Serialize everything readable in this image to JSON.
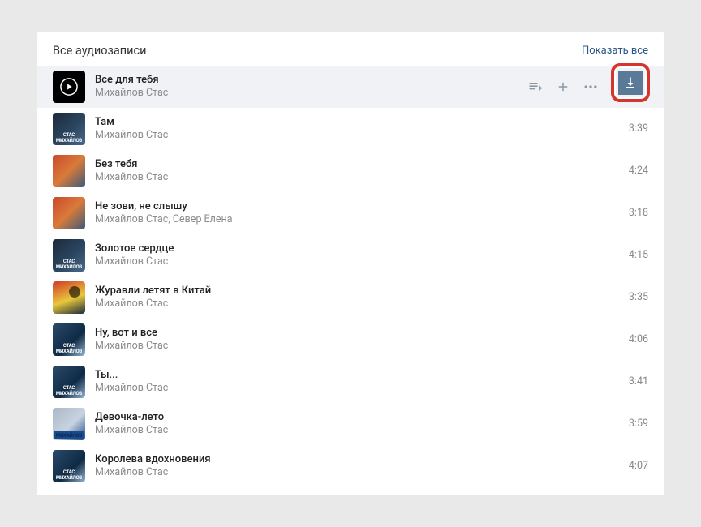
{
  "header": {
    "title": "Все аудиозаписи",
    "show_all": "Показать все"
  },
  "tracks": [
    {
      "title": "Все для тебя",
      "artist": "Михайлов Стас",
      "duration": "",
      "active": true,
      "thumb": "play"
    },
    {
      "title": "Там",
      "artist": "Михайлов Стас",
      "duration": "3:39",
      "thumb": "a"
    },
    {
      "title": "Без тебя",
      "artist": "Михайлов Стас",
      "duration": "4:24",
      "thumb": "b"
    },
    {
      "title": "Не зови, не слышу",
      "artist": "Михайлов Стас, Север Елена",
      "duration": "3:18",
      "thumb": "b"
    },
    {
      "title": "Золотое сердце",
      "artist": "Михайлов Стас",
      "duration": "4:15",
      "thumb": "a"
    },
    {
      "title": "Журавли летят в Китай",
      "artist": "Михайлов Стас",
      "duration": "3:35",
      "thumb": "c"
    },
    {
      "title": "Ну, вот и все",
      "artist": "Михайлов Стас",
      "duration": "4:06",
      "thumb": "d"
    },
    {
      "title": "Ты...",
      "artist": "Михайлов Стас",
      "duration": "3:41",
      "thumb": "d"
    },
    {
      "title": "Девочка-лето",
      "artist": "Михайлов Стас",
      "duration": "3:59",
      "thumb": "e"
    },
    {
      "title": "Королева вдохновения",
      "artist": "Михайлов Стас",
      "duration": "4:07",
      "thumb": "d"
    }
  ]
}
